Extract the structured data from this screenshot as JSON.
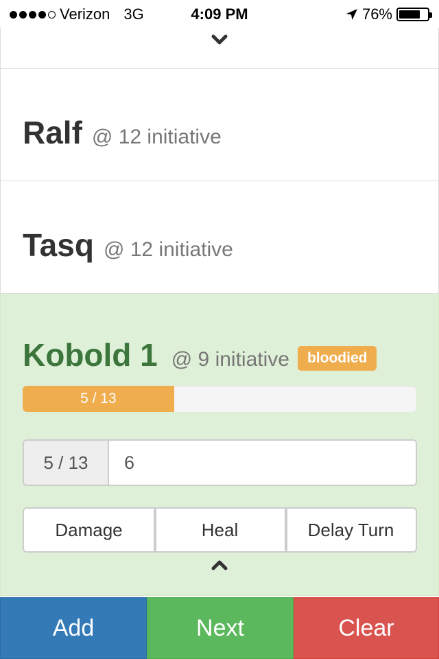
{
  "status_bar": {
    "carrier": "Verizon",
    "network": "3G",
    "time": "4:09 PM",
    "battery": "76%",
    "battery_level": 0.76,
    "signal_bars_filled": 4,
    "signal_bars_total": 5
  },
  "combatants": [
    {
      "name": "Ralf",
      "initiative": "@ 12 initiative"
    },
    {
      "name": "Tasq",
      "initiative": "@ 12 initiative"
    }
  ],
  "active": {
    "name": "Kobold 1",
    "initiative": "@ 9 initiative",
    "badge": "bloodied",
    "hp_text": "5 / 13",
    "hp_current": 5,
    "hp_max": 13,
    "addon": "5 / 13",
    "amount_value": "6",
    "buttons": {
      "damage": "Damage",
      "heal": "Heal",
      "delay": "Delay Turn"
    }
  },
  "footer": {
    "add": "Add",
    "next": "Next",
    "clear": "Clear"
  },
  "colors": {
    "primary": "#337ab7",
    "success": "#5cb85c",
    "danger": "#d9534f",
    "warning": "#f0ad4e",
    "active_bg": "#dff0d8",
    "active_text": "#3c763d"
  },
  "icons": {
    "collapse_top": "chevron-down-icon",
    "collapse_bottom": "chevron-up-icon",
    "location": "location-arrow-icon",
    "battery": "battery-icon"
  }
}
